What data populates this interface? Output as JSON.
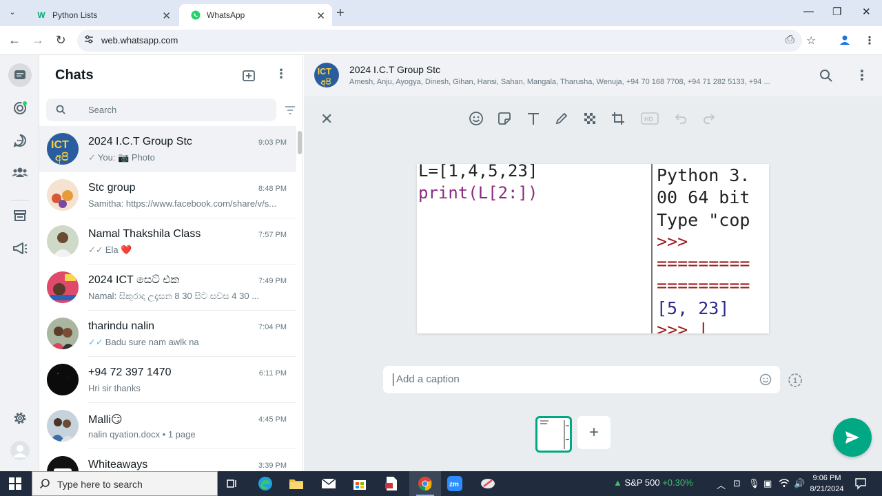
{
  "browser": {
    "tabs": [
      {
        "title": "Python Lists"
      },
      {
        "title": "WhatsApp"
      }
    ],
    "url": "web.whatsapp.com"
  },
  "sidebar": {
    "title": "Chats",
    "search_placeholder": "Search"
  },
  "chats": [
    {
      "name": "2024 I.C.T Group Stc",
      "time": "9:03 PM",
      "preview": "You: 📷 Photo",
      "tick": "single"
    },
    {
      "name": "Stc group",
      "time": "8:48 PM",
      "preview": "Samitha: https://www.facebook.com/share/v/s...",
      "tick": ""
    },
    {
      "name": "Namal Thakshila Class",
      "time": "7:57 PM",
      "preview": "Ela ❤️",
      "tick": "double"
    },
    {
      "name": "2024 ICT සෙට් එක",
      "time": "7:49 PM",
      "preview": "Namal: සිකුරාදා උදෑසන 8 30 සිට සවස 4 30 ...",
      "tick": ""
    },
    {
      "name": "tharindu nalin",
      "time": "7:04 PM",
      "preview": "Badu sure nam awlk na",
      "tick": "blue"
    },
    {
      "name": "+94 72 397 1470",
      "time": "6:11 PM",
      "preview": "Hri sir thanks",
      "tick": ""
    },
    {
      "name": "Malli😏",
      "time": "4:45 PM",
      "preview": "nalin qyation.docx • 1 page",
      "tick": ""
    },
    {
      "name": "Whiteaways",
      "time": "3:39 PM",
      "preview": "",
      "tick": ""
    }
  ],
  "conversation": {
    "name": "2024 I.C.T Group Stc",
    "members": "Amesh, Anju, Ayogya, Dinesh, Gihan, Hansi, Sahan, Mangala, Tharusha, Wenuja, +94 70 168 7708, +94 71 282 5133, +94 ..."
  },
  "preview_image": {
    "code_lines": [
      "L=[1,4,5,23]",
      "print(L[2:])"
    ],
    "shell_lines": [
      "Python 3.",
      "00 64 bit",
      "Type \"cop",
      ">>>",
      "=========",
      "=========",
      "[5, 23]",
      ">>> |"
    ]
  },
  "caption": {
    "placeholder": "Add a caption"
  },
  "taskbar": {
    "search_text": "Type here to search",
    "stock_name": "S&P 500",
    "stock_change": "+0.30%",
    "time": "9:06 PM",
    "date": "8/21/2024"
  },
  "colors": {
    "accent": "#00a884",
    "chrome_tab_bg": "#dfe7f5",
    "taskbar": "#202b3d"
  }
}
